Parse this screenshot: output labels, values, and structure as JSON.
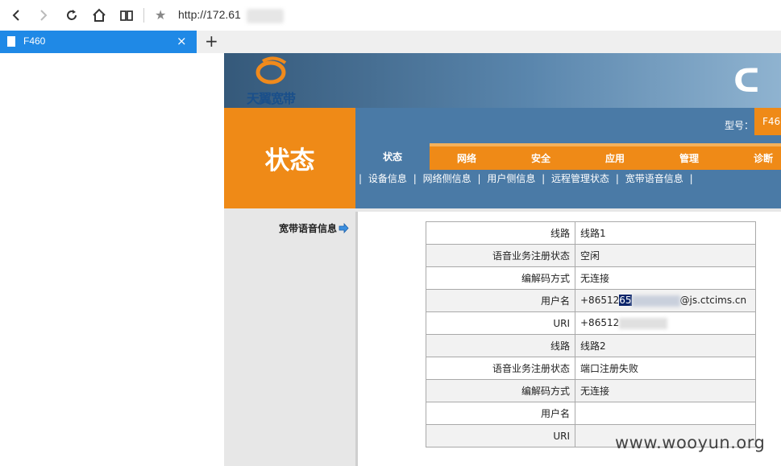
{
  "browser": {
    "url": "http://172.61",
    "tab_title": "F460",
    "tab_close": "×",
    "new_tab": "+",
    "bookmark_star": "★"
  },
  "router": {
    "brand": "天翼宽带",
    "emblem": "ᑕ",
    "section_title": "状态",
    "model_label": "型号：",
    "model_value": "F46",
    "tabs": [
      "状态",
      "网络",
      "安全",
      "应用",
      "管理",
      "诊断"
    ],
    "subnav": [
      "|",
      "设备信息",
      "|",
      "网络侧信息",
      "|",
      "用户侧信息",
      "|",
      "远程管理状态",
      "|",
      "宽带语音信息",
      "|"
    ],
    "left_nav_item": "宽带语音信息",
    "rows": [
      {
        "key": "线路",
        "value": "线路1"
      },
      {
        "key": "语音业务注册状态",
        "value": "空闲"
      },
      {
        "key": "编解码方式",
        "value": "无连接"
      },
      {
        "key": "用户名",
        "value_prefix": "+86512",
        "value_hl": "65",
        "value_suffix": "@js.ctcims.cn"
      },
      {
        "key": "URI",
        "value_prefix": "+86512"
      },
      {
        "key": "线路",
        "value": "线路2"
      },
      {
        "key": "语音业务注册状态",
        "value": "端口注册失败"
      },
      {
        "key": "编解码方式",
        "value": "无连接"
      },
      {
        "key": "用户名",
        "value": ""
      },
      {
        "key": "URI",
        "value": ""
      }
    ]
  },
  "watermark": "www.wooyun.org",
  "colors": {
    "orange": "#ef8a17",
    "nav_blue": "#4a7aa6",
    "tab_blue": "#1f89e6"
  }
}
